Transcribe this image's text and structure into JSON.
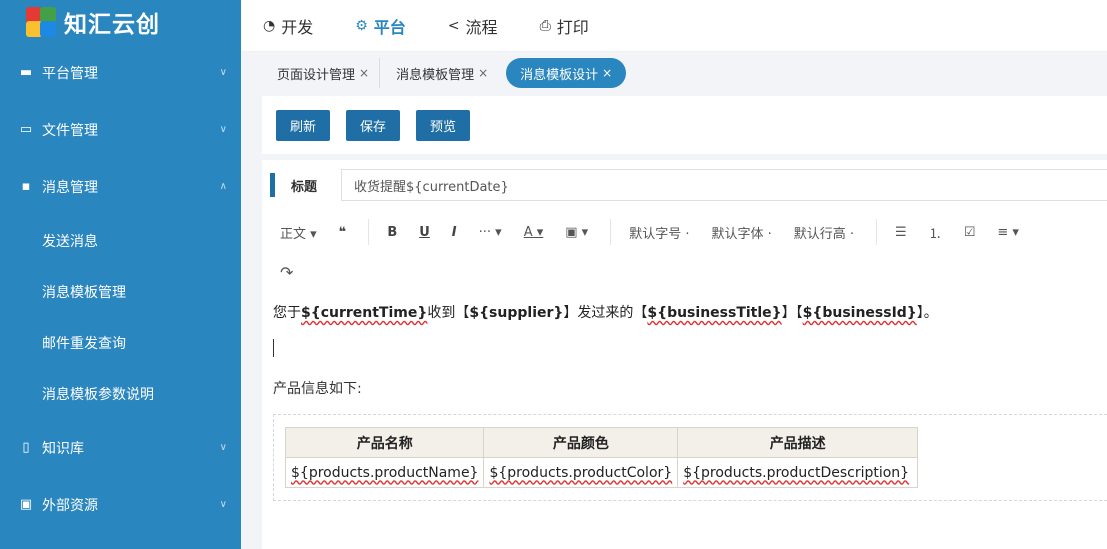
{
  "brand": {
    "name": "知汇云创"
  },
  "sidebar": {
    "items": [
      {
        "label": "平台管理",
        "icon": "monitor-icon",
        "chevron": "∨"
      },
      {
        "label": "文件管理",
        "icon": "folder-icon",
        "chevron": "∨"
      },
      {
        "label": "消息管理",
        "icon": "message-icon",
        "chevron": "∧"
      }
    ],
    "subitems": [
      "发送消息",
      "消息模板管理",
      "邮件重发查询",
      "消息模板参数说明"
    ],
    "items_after": [
      {
        "label": "知识库",
        "icon": "book-icon",
        "chevron": "∨"
      },
      {
        "label": "外部资源",
        "icon": "image-icon",
        "chevron": "∨"
      }
    ]
  },
  "topnav": {
    "tabs": [
      {
        "label": "开发",
        "icon": "dev-icon"
      },
      {
        "label": "平台",
        "icon": "gear-icon",
        "active": true
      },
      {
        "label": "流程",
        "icon": "share-icon"
      },
      {
        "label": "打印",
        "icon": "printer-icon"
      }
    ]
  },
  "pagetabs": {
    "tabs": [
      {
        "label": "页面设计管理"
      },
      {
        "label": "消息模板管理"
      },
      {
        "label": "消息模板设计",
        "active": true
      }
    ],
    "close": "×"
  },
  "toolbar": {
    "refresh": "刷新",
    "save": "保存",
    "preview": "预览"
  },
  "editor": {
    "title_label": "标题",
    "title_value": "收货提醒${currentDate}",
    "toolbar": {
      "paragraph": "正文 ▾",
      "quote": "❝",
      "bold": "B",
      "underline": "U",
      "italic": "I",
      "more": "··· ▾",
      "font_color": "A ▾",
      "bg_color": "▣ ▾",
      "font_size": "默认字号 ·",
      "font_family": "默认字体 ·",
      "line_height": "默认行高 ·",
      "bullet_list": "☰",
      "numbered_list": "⒈",
      "todo": "☑",
      "align": "≡ ▾",
      "redo": "↷"
    },
    "content": {
      "p1": {
        "a": "您于",
        "b": "${currentTime}",
        "c": "收到【",
        "d": "${supplier}",
        "e": "】发过来的【",
        "f": "${businessTitle}",
        "g": "】【",
        "h": "${businessId}",
        "i": "】。"
      },
      "p3": "产品信息如下:",
      "table": {
        "headers": [
          "产品名称",
          "产品颜色",
          "产品描述"
        ],
        "row": [
          "${products.productName}",
          "${products.productColor}",
          "${products.productDescription}"
        ]
      }
    }
  },
  "colors": {
    "sidebar": "#2a86bf",
    "accent": "#1f6fa6",
    "active_tab": "#2a86bf"
  }
}
